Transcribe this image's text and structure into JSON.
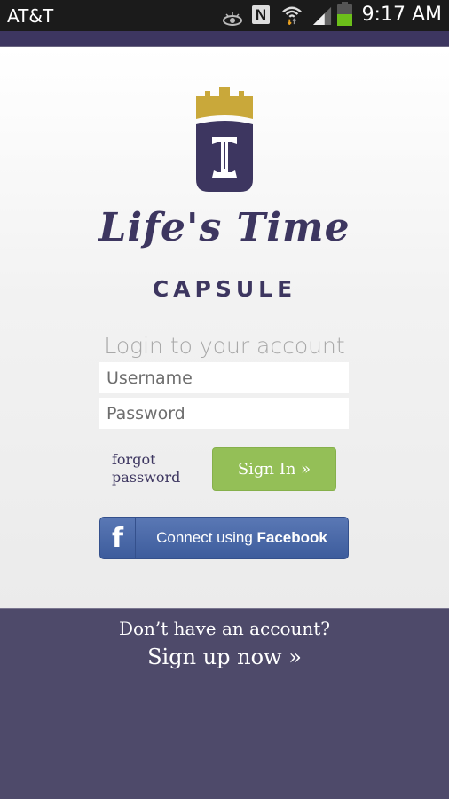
{
  "status_bar": {
    "carrier": "AT&T",
    "time": "9:17 AM",
    "icons": [
      "eye-icon",
      "nfc-icon",
      "wifi-icon",
      "signal-icon",
      "battery-icon"
    ],
    "nfc_glyph": "N",
    "battery_level": 0.55
  },
  "logo": {
    "script_text": "Life's Time",
    "subtitle": "CAPSULE",
    "colors": {
      "crown": "#c9a83a",
      "shield": "#3d3660"
    }
  },
  "login": {
    "title": "Login to your account",
    "username_placeholder": "Username",
    "password_placeholder": "Password",
    "forgot_label": "forgot password",
    "signin_label": "Sign In »",
    "facebook_prefix": "Connect using ",
    "facebook_bold": "Facebook",
    "facebook_glyph": "f"
  },
  "footer": {
    "prompt": "Don’t have an account?",
    "signup_label": "Sign up now »"
  },
  "colors": {
    "brand_purple": "#3d3660",
    "footer_purple": "#4e4a6a",
    "signin_green": "#94bf57",
    "facebook_blue": "#4a68a8"
  }
}
